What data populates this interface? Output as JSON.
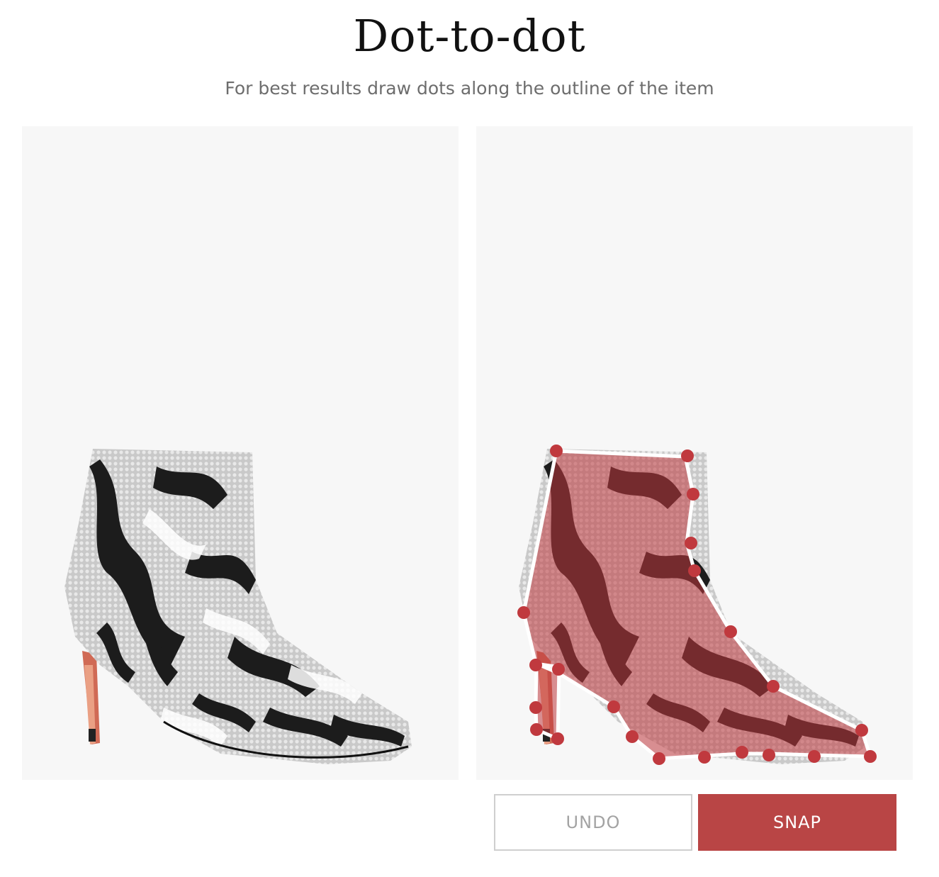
{
  "header": {
    "title": "Dot-to-dot",
    "subtitle": "For best results draw dots along the outline of the item"
  },
  "source_image": {
    "description_icon": "snakeskin-ankle-boot"
  },
  "editor_image": {
    "description_icon": "snakeskin-ankle-boot",
    "selection_color": "#c0393e",
    "dot_color": "#c0393e",
    "dot_count": 24
  },
  "actions": {
    "undo_label": "UNDO",
    "snap_label": "SNAP"
  },
  "colors": {
    "accent": "#b94545",
    "panel_bg": "#f7f7f7"
  }
}
